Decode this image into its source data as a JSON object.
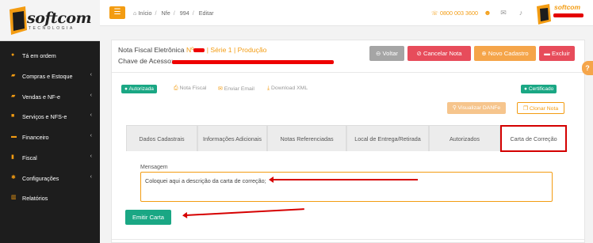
{
  "sidebar": {
    "logo_text": "softcom",
    "logo_sub": "TECNOLOGIA",
    "items": [
      {
        "label": "Tá em ordem",
        "icon": "dot-icon",
        "has_chevron": false
      },
      {
        "label": "Compras e Estoque",
        "icon": "cart-icon",
        "has_chevron": true
      },
      {
        "label": "Vendas e NF-e",
        "icon": "cart-icon",
        "has_chevron": true
      },
      {
        "label": "Serviços e NFS-e",
        "icon": "briefcase-icon",
        "has_chevron": true
      },
      {
        "label": "Financeiro",
        "icon": "money-icon",
        "has_chevron": true
      },
      {
        "label": "Fiscal",
        "icon": "document-icon",
        "has_chevron": true
      },
      {
        "label": "Configurações",
        "icon": "gear-icon",
        "has_chevron": true
      },
      {
        "label": "Relatórios",
        "icon": "chart-icon",
        "has_chevron": false
      }
    ]
  },
  "topbar": {
    "breadcrumb": [
      "Início",
      "Nfe",
      "994",
      "Editar"
    ],
    "phone": "0800 003 3600",
    "brand_text": "softcom"
  },
  "header": {
    "title": "Nota Fiscal Eletrônica",
    "number_prefix": "Nº",
    "series": "| Série 1 | Produção",
    "key_label": "Chave de Acesso:"
  },
  "buttons": {
    "voltar": "Voltar",
    "cancelar": "Cancelar Nota",
    "novo": "Novo Cadastro",
    "excluir": "Excluir",
    "visualizar": "Visualizar DANFe",
    "clonar": "Clonar Nota",
    "emitir": "Emitir Carta"
  },
  "status": {
    "autorizada": "Autorizada",
    "certificado": "Certificado"
  },
  "actions": {
    "nota_fiscal": "Nota Fiscal",
    "enviar_email": "Enviar Email",
    "download_xml": "Download XML"
  },
  "tabs": [
    {
      "label": "Dados Cadastrais"
    },
    {
      "label": "Informações Adicionais"
    },
    {
      "label": "Notas Referenciadas"
    },
    {
      "label": "Local de Entrega/Retirada"
    },
    {
      "label": "Autorizados"
    },
    {
      "label": "Carta de Correção",
      "active": true
    }
  ],
  "form": {
    "message_label": "Mensagem",
    "message_value": "Coloquei aqui a descrição da carta de correção;"
  },
  "colors": {
    "accent": "#f39c12",
    "success": "#1aa784",
    "danger": "#e74c5b",
    "highlight": "#d40000",
    "sidebar": "#1d1d1d"
  }
}
